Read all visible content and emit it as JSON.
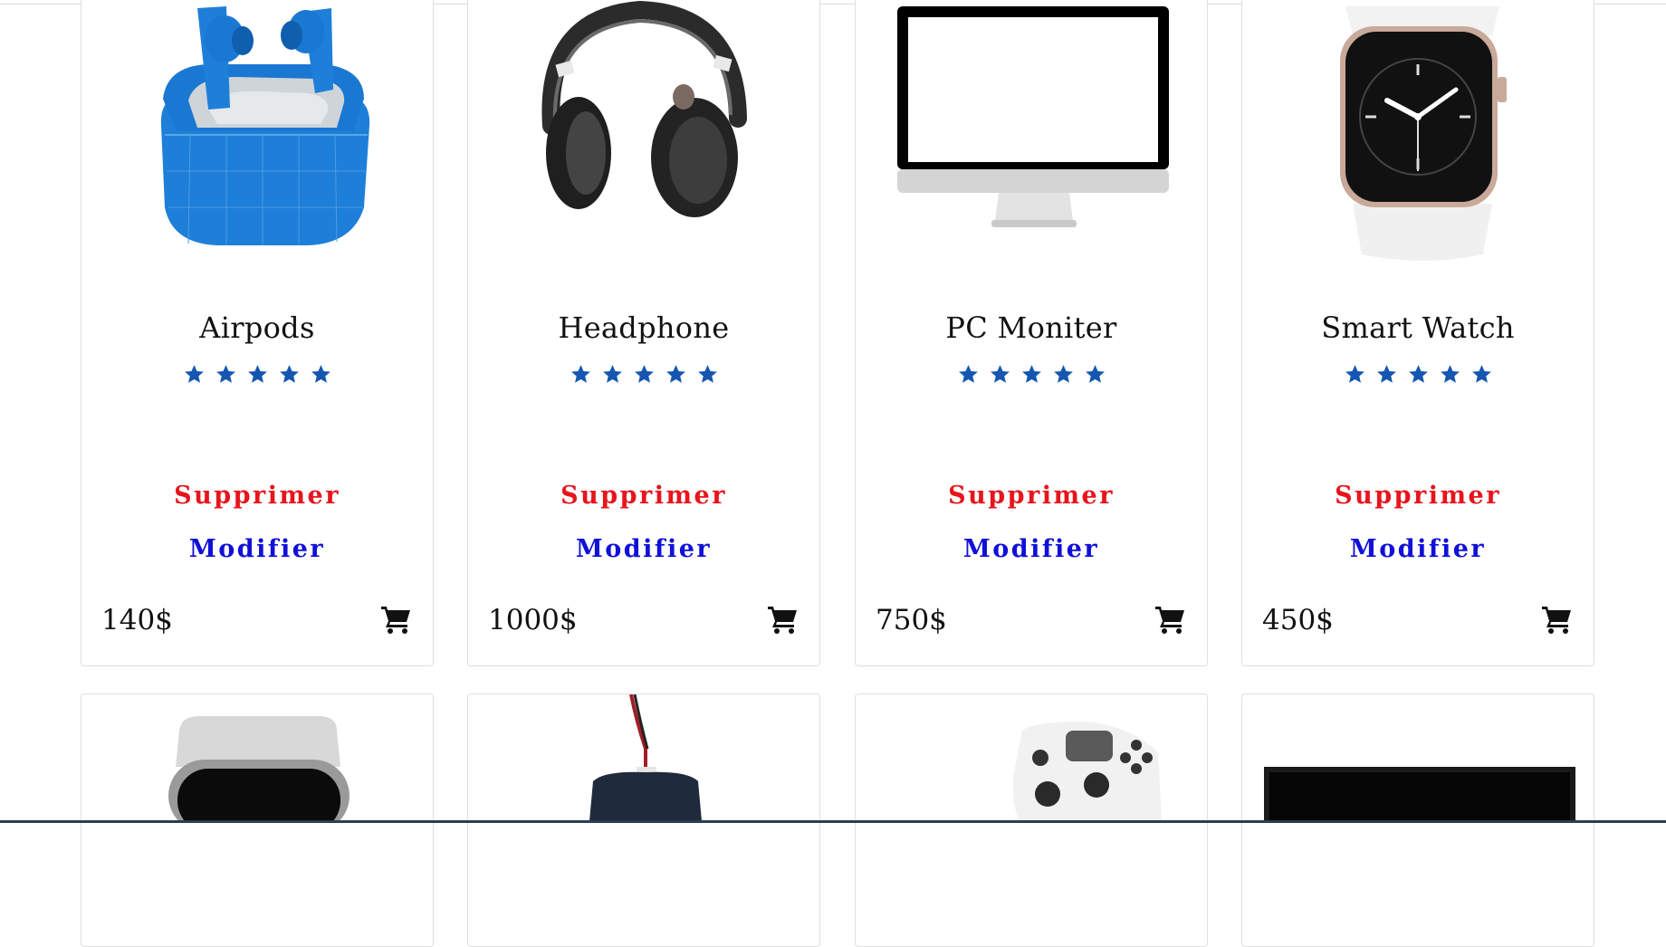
{
  "products": [
    {
      "name": "Airpods",
      "rating": 5,
      "price": "140$",
      "delete_label": "Supprimer",
      "edit_label": "Modifier"
    },
    {
      "name": "Headphone",
      "rating": 5,
      "price": "1000$",
      "delete_label": "Supprimer",
      "edit_label": "Modifier"
    },
    {
      "name": "PC Moniter",
      "rating": 5,
      "price": "750$",
      "delete_label": "Supprimer",
      "edit_label": "Modifier"
    },
    {
      "name": "Smart Watch",
      "rating": 5,
      "price": "450$",
      "delete_label": "Supprimer",
      "edit_label": "Modifier"
    }
  ],
  "second_row_images": [
    "smart-watch-image",
    "gaming-mouse-image",
    "game-controller-image",
    "monitor-image"
  ],
  "colors": {
    "star": "#1557b0",
    "delete": "#e8141c",
    "edit": "#1010d8",
    "cart": "#111111"
  },
  "icons": {
    "rating": "star-icon",
    "cart": "cart-icon"
  }
}
